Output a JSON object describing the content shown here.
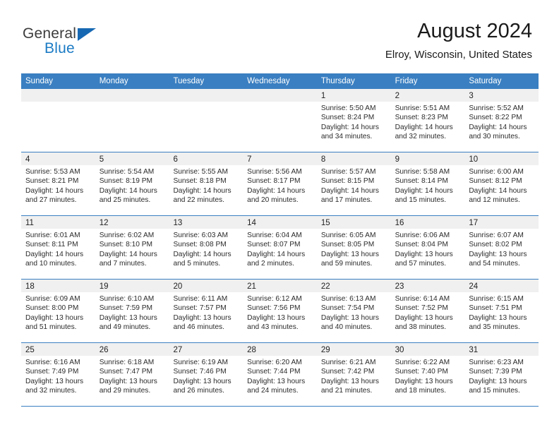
{
  "brand": {
    "name_part1": "General",
    "name_part2": "Blue",
    "logo_icon": "triangle-logo-icon",
    "accent_color": "#1668b3"
  },
  "header": {
    "month_title": "August 2024",
    "location": "Elroy, Wisconsin, United States"
  },
  "calendar": {
    "header_color": "#3a7fc1",
    "weekdays": [
      "Sunday",
      "Monday",
      "Tuesday",
      "Wednesday",
      "Thursday",
      "Friday",
      "Saturday"
    ],
    "weeks": [
      [
        {
          "day": "",
          "lines": []
        },
        {
          "day": "",
          "lines": []
        },
        {
          "day": "",
          "lines": []
        },
        {
          "day": "",
          "lines": []
        },
        {
          "day": "1",
          "lines": [
            "Sunrise: 5:50 AM",
            "Sunset: 8:24 PM",
            "Daylight: 14 hours",
            "and 34 minutes."
          ]
        },
        {
          "day": "2",
          "lines": [
            "Sunrise: 5:51 AM",
            "Sunset: 8:23 PM",
            "Daylight: 14 hours",
            "and 32 minutes."
          ]
        },
        {
          "day": "3",
          "lines": [
            "Sunrise: 5:52 AM",
            "Sunset: 8:22 PM",
            "Daylight: 14 hours",
            "and 30 minutes."
          ]
        }
      ],
      [
        {
          "day": "4",
          "lines": [
            "Sunrise: 5:53 AM",
            "Sunset: 8:21 PM",
            "Daylight: 14 hours",
            "and 27 minutes."
          ]
        },
        {
          "day": "5",
          "lines": [
            "Sunrise: 5:54 AM",
            "Sunset: 8:19 PM",
            "Daylight: 14 hours",
            "and 25 minutes."
          ]
        },
        {
          "day": "6",
          "lines": [
            "Sunrise: 5:55 AM",
            "Sunset: 8:18 PM",
            "Daylight: 14 hours",
            "and 22 minutes."
          ]
        },
        {
          "day": "7",
          "lines": [
            "Sunrise: 5:56 AM",
            "Sunset: 8:17 PM",
            "Daylight: 14 hours",
            "and 20 minutes."
          ]
        },
        {
          "day": "8",
          "lines": [
            "Sunrise: 5:57 AM",
            "Sunset: 8:15 PM",
            "Daylight: 14 hours",
            "and 17 minutes."
          ]
        },
        {
          "day": "9",
          "lines": [
            "Sunrise: 5:58 AM",
            "Sunset: 8:14 PM",
            "Daylight: 14 hours",
            "and 15 minutes."
          ]
        },
        {
          "day": "10",
          "lines": [
            "Sunrise: 6:00 AM",
            "Sunset: 8:12 PM",
            "Daylight: 14 hours",
            "and 12 minutes."
          ]
        }
      ],
      [
        {
          "day": "11",
          "lines": [
            "Sunrise: 6:01 AM",
            "Sunset: 8:11 PM",
            "Daylight: 14 hours",
            "and 10 minutes."
          ]
        },
        {
          "day": "12",
          "lines": [
            "Sunrise: 6:02 AM",
            "Sunset: 8:10 PM",
            "Daylight: 14 hours",
            "and 7 minutes."
          ]
        },
        {
          "day": "13",
          "lines": [
            "Sunrise: 6:03 AM",
            "Sunset: 8:08 PM",
            "Daylight: 14 hours",
            "and 5 minutes."
          ]
        },
        {
          "day": "14",
          "lines": [
            "Sunrise: 6:04 AM",
            "Sunset: 8:07 PM",
            "Daylight: 14 hours",
            "and 2 minutes."
          ]
        },
        {
          "day": "15",
          "lines": [
            "Sunrise: 6:05 AM",
            "Sunset: 8:05 PM",
            "Daylight: 13 hours",
            "and 59 minutes."
          ]
        },
        {
          "day": "16",
          "lines": [
            "Sunrise: 6:06 AM",
            "Sunset: 8:04 PM",
            "Daylight: 13 hours",
            "and 57 minutes."
          ]
        },
        {
          "day": "17",
          "lines": [
            "Sunrise: 6:07 AM",
            "Sunset: 8:02 PM",
            "Daylight: 13 hours",
            "and 54 minutes."
          ]
        }
      ],
      [
        {
          "day": "18",
          "lines": [
            "Sunrise: 6:09 AM",
            "Sunset: 8:00 PM",
            "Daylight: 13 hours",
            "and 51 minutes."
          ]
        },
        {
          "day": "19",
          "lines": [
            "Sunrise: 6:10 AM",
            "Sunset: 7:59 PM",
            "Daylight: 13 hours",
            "and 49 minutes."
          ]
        },
        {
          "day": "20",
          "lines": [
            "Sunrise: 6:11 AM",
            "Sunset: 7:57 PM",
            "Daylight: 13 hours",
            "and 46 minutes."
          ]
        },
        {
          "day": "21",
          "lines": [
            "Sunrise: 6:12 AM",
            "Sunset: 7:56 PM",
            "Daylight: 13 hours",
            "and 43 minutes."
          ]
        },
        {
          "day": "22",
          "lines": [
            "Sunrise: 6:13 AM",
            "Sunset: 7:54 PM",
            "Daylight: 13 hours",
            "and 40 minutes."
          ]
        },
        {
          "day": "23",
          "lines": [
            "Sunrise: 6:14 AM",
            "Sunset: 7:52 PM",
            "Daylight: 13 hours",
            "and 38 minutes."
          ]
        },
        {
          "day": "24",
          "lines": [
            "Sunrise: 6:15 AM",
            "Sunset: 7:51 PM",
            "Daylight: 13 hours",
            "and 35 minutes."
          ]
        }
      ],
      [
        {
          "day": "25",
          "lines": [
            "Sunrise: 6:16 AM",
            "Sunset: 7:49 PM",
            "Daylight: 13 hours",
            "and 32 minutes."
          ]
        },
        {
          "day": "26",
          "lines": [
            "Sunrise: 6:18 AM",
            "Sunset: 7:47 PM",
            "Daylight: 13 hours",
            "and 29 minutes."
          ]
        },
        {
          "day": "27",
          "lines": [
            "Sunrise: 6:19 AM",
            "Sunset: 7:46 PM",
            "Daylight: 13 hours",
            "and 26 minutes."
          ]
        },
        {
          "day": "28",
          "lines": [
            "Sunrise: 6:20 AM",
            "Sunset: 7:44 PM",
            "Daylight: 13 hours",
            "and 24 minutes."
          ]
        },
        {
          "day": "29",
          "lines": [
            "Sunrise: 6:21 AM",
            "Sunset: 7:42 PM",
            "Daylight: 13 hours",
            "and 21 minutes."
          ]
        },
        {
          "day": "30",
          "lines": [
            "Sunrise: 6:22 AM",
            "Sunset: 7:40 PM",
            "Daylight: 13 hours",
            "and 18 minutes."
          ]
        },
        {
          "day": "31",
          "lines": [
            "Sunrise: 6:23 AM",
            "Sunset: 7:39 PM",
            "Daylight: 13 hours",
            "and 15 minutes."
          ]
        }
      ]
    ]
  }
}
